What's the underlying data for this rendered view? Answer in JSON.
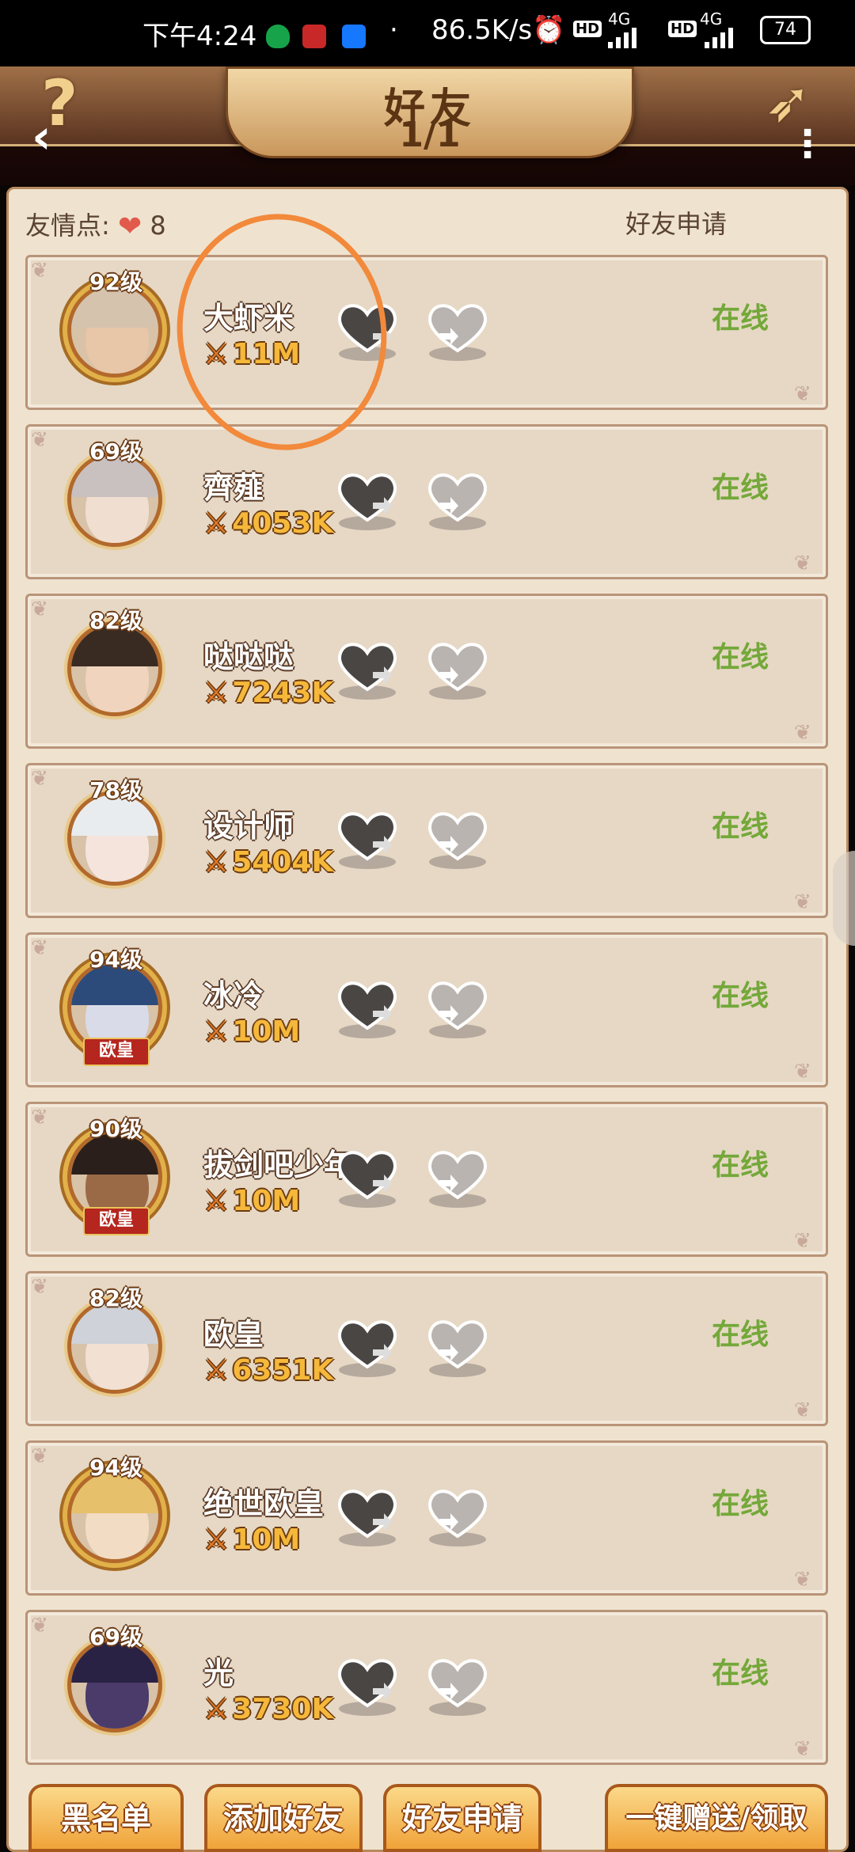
{
  "status_bar": {
    "time": "下午4:24",
    "network_speed": "86.5K/s",
    "hd1": "HD",
    "sig1": "4G",
    "hd2": "HD",
    "sig2": "4G",
    "battery": "74"
  },
  "header": {
    "title": "好友",
    "pager": "1/1",
    "help_icon": "question-mark-icon",
    "back_icon": "chevron-left-icon",
    "more_icon": "more-dots-icon"
  },
  "top": {
    "friendship_label": "友情点:",
    "friendship_value": "8",
    "friend_requests_link": "好友申请"
  },
  "friends": [
    {
      "level": "92级",
      "name": "大虾米",
      "power": "11M",
      "status": "在线",
      "frame": "gold"
    },
    {
      "level": "69级",
      "name": "齊薤",
      "power": "4053K",
      "status": "在线",
      "frame": "normal"
    },
    {
      "level": "82级",
      "name": "哒哒哒",
      "power": "7243K",
      "status": "在线",
      "frame": "normal"
    },
    {
      "level": "78级",
      "name": "设计师",
      "power": "5404K",
      "status": "在线",
      "frame": "normal"
    },
    {
      "level": "94级",
      "name": "冰冷",
      "power": "10M",
      "status": "在线",
      "frame": "gold",
      "badge": "欧皇"
    },
    {
      "level": "90级",
      "name": "拔剑吧少年",
      "power": "10M",
      "status": "在线",
      "frame": "gold",
      "badge": "欧皇"
    },
    {
      "level": "82级",
      "name": "欧皇",
      "power": "6351K",
      "status": "在线",
      "frame": "normal"
    },
    {
      "level": "94级",
      "name": "绝世欧皇",
      "power": "10M",
      "status": "在线",
      "frame": "gold"
    },
    {
      "level": "69级",
      "name": "光",
      "power": "3730K",
      "status": "在线",
      "frame": "normal"
    }
  ],
  "bottom_buttons": {
    "blacklist": "黑名单",
    "add_friend": "添加好友",
    "friend_requests": "好友申请",
    "send_receive_all": "一键赠送/领取"
  },
  "colors": {
    "online": "#74a83a",
    "panel": "#efe3cf",
    "card": "#e6d8c4",
    "annotation_circle": "#f2893b"
  }
}
